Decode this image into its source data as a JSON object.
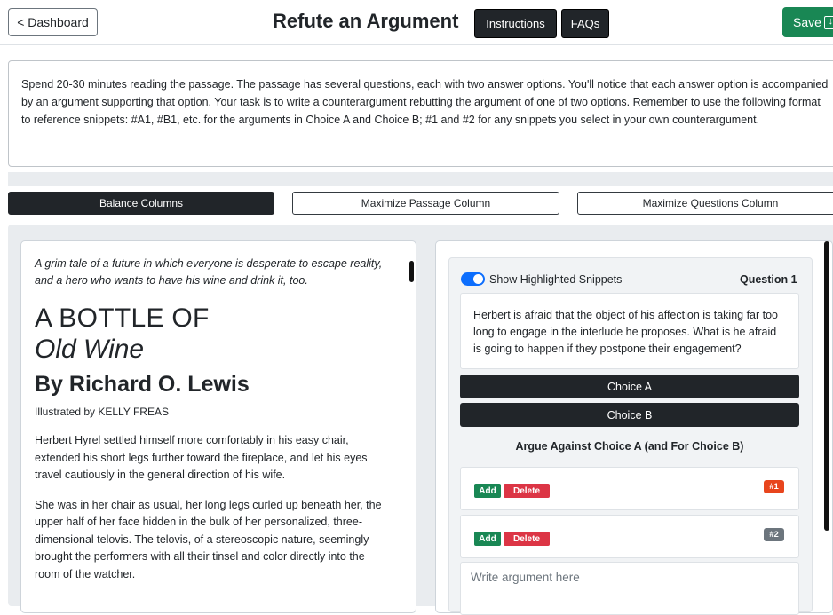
{
  "header": {
    "dashboard_label": "< Dashboard",
    "title": "Refute an Argument",
    "instructions_label": "Instructions",
    "faqs_label": "FAQs",
    "save_label": "Save",
    "save_icon": "download-icon"
  },
  "instructions_text": "Spend 20-30 minutes reading the passage. The passage has several questions, each with two answer options. You'll notice that each answer option is accompanied by an argument supporting that option. Your task is to write a counterargument rebutting the argument of one of two options. Remember to use the following format to reference snippets: #A1, #B1, etc. for the arguments in Choice A and Choice B; #1 and #2 for any snippets you select in your own counterargument.",
  "column_controls": {
    "balance": "Balance Columns",
    "maximize_passage": "Maximize Passage Column",
    "maximize_questions": "Maximize Questions Column"
  },
  "passage": {
    "tagline": "A grim tale of a future in which everyone is desperate to escape reality, and a hero who wants to have his wine and drink it, too.",
    "title_line1": "A BOTTLE OF",
    "title_line2": "Old Wine",
    "author": "By Richard O. Lewis",
    "illustrated": "Illustrated by KELLY FREAS",
    "paragraphs": [
      "Herbert Hyrel settled himself more comfortably in his easy chair, extended his short legs further toward the fireplace, and let his eyes travel cautiously in the general direction of his wife.",
      "She was in her chair as usual, her long legs curled up beneath her, the upper half of her face hidden in the bulk of her personalized, three-dimensional telovis. The telovis, of a stereoscopic nature, seemingly brought the performers with all their tinsel and color directly into the room of the watcher."
    ]
  },
  "question": {
    "toggle_label": "Show Highlighted Snippets",
    "toggle_on": true,
    "number_label": "Question 1",
    "text": "Herbert is afraid that the object of his affection is taking far too long to engage in the interlude he proposes. What is he afraid is going to happen if they postpone their engagement?",
    "choice_a": "Choice A",
    "choice_b": "Choice B",
    "argue_heading": "Argue Against Choice A (and For Choice B)",
    "snippets": [
      {
        "add": "Add",
        "delete": "Delete",
        "badge": "#1",
        "badge_color": "#e8451d"
      },
      {
        "add": "Add",
        "delete": "Delete",
        "badge": "#2",
        "badge_color": "#6c757d"
      }
    ],
    "argument_placeholder": "Write argument here"
  },
  "colors": {
    "save_green": "#198754",
    "dark": "#212529",
    "toggle_blue": "#0d6efd",
    "delete_red": "#dc3545"
  }
}
